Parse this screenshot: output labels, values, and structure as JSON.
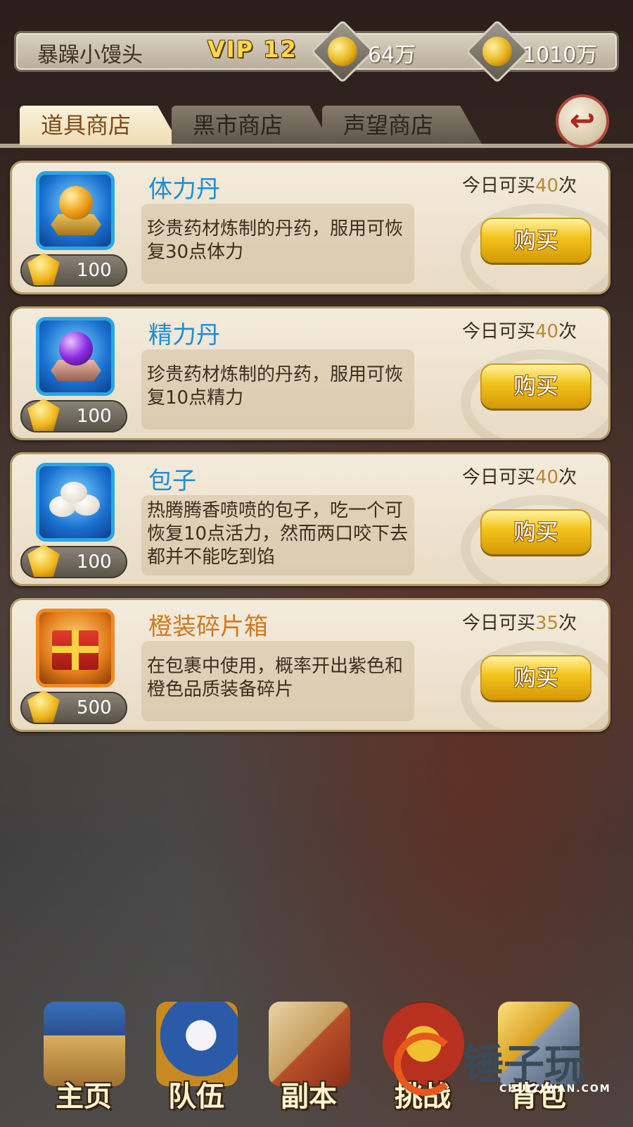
{
  "top_bar": {
    "player_name": "暴躁小馒头",
    "vip_label": "VIP 12",
    "copper": "64万",
    "gold": "1010万"
  },
  "tabs": [
    {
      "label": "道具商店",
      "active": true
    },
    {
      "label": "黑市商店",
      "active": false
    },
    {
      "label": "声望商店",
      "active": false
    }
  ],
  "back_icon": "back-arrow-icon",
  "items": [
    {
      "name": "体力丹",
      "description": "珍贵药材炼制的丹药，服用可恢复30点体力",
      "limit_prefix": "今日可买",
      "limit_count": "40",
      "limit_suffix": "次",
      "price": "100",
      "buy_label": "购买"
    },
    {
      "name": "精力丹",
      "description": "珍贵药材炼制的丹药，服用可恢复10点精力",
      "limit_prefix": "今日可买",
      "limit_count": "40",
      "limit_suffix": "次",
      "price": "100",
      "buy_label": "购买"
    },
    {
      "name": "包子",
      "description": "热腾腾香喷喷的包子，吃一个可恢复10点活力，然而两口咬下去都并不能吃到馅",
      "limit_prefix": "今日可买",
      "limit_count": "40",
      "limit_suffix": "次",
      "price": "100",
      "buy_label": "购买"
    },
    {
      "name": "橙装碎片箱",
      "description": "在包裹中使用，概率开出紫色和橙色品质装备碎片",
      "limit_prefix": "今日可买",
      "limit_count": "35",
      "limit_suffix": "次",
      "price": "500",
      "buy_label": "购买"
    }
  ],
  "bottom_nav": [
    {
      "label": "主页",
      "icon": "palace-icon"
    },
    {
      "label": "队伍",
      "icon": "team-banner-icon"
    },
    {
      "label": "副本",
      "icon": "dungeon-scroll-icon"
    },
    {
      "label": "挑战",
      "icon": "challenge-gong-icon"
    },
    {
      "label": "背包",
      "icon": "sword-icon"
    }
  ],
  "watermark": {
    "text": "锤子玩",
    "sub": "CHUIZIWAN.COM"
  },
  "colors": {
    "name_blue": "#1d8ed1",
    "name_orange": "#d07a20",
    "limit_num": "#b88a34",
    "buy_gold": "#f2c21a"
  }
}
